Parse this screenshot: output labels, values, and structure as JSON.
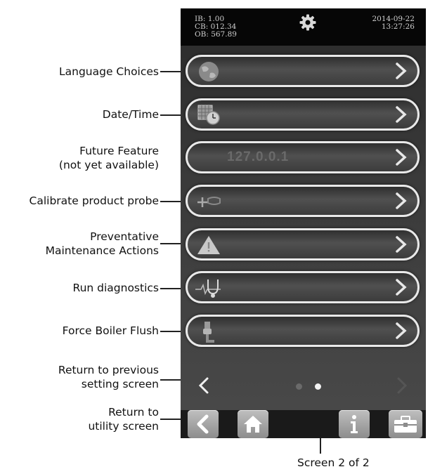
{
  "callouts": {
    "language": "Language Choices",
    "datetime": "Date/Time",
    "future_1": "Future Feature",
    "future_2": "(not yet available)",
    "calibrate": "Calibrate product probe",
    "maint_1": "Preventative",
    "maint_2": "Maintenance Actions",
    "diagnostics": "Run diagnostics",
    "boiler": "Force Boiler Flush",
    "prev_1": "Return to previous",
    "prev_2": "setting screen",
    "utility_1": "Return to",
    "utility_2": "utility screen",
    "screen_count": "Screen 2 of 2"
  },
  "status": {
    "ib": "IB: 1.00",
    "cb": "CB: 012.34",
    "ob": "OB: 567.89",
    "date": "2014-09-22",
    "time": "13:27:26"
  },
  "rows": {
    "future_text": "127.0.0.1"
  },
  "icons": [
    "gear-icon",
    "globe-icon",
    "calendar-clock-icon",
    "probe-icon",
    "warning-icon",
    "stethoscope-icon",
    "valve-icon",
    "chevron-right-icon",
    "back-icon",
    "home-icon",
    "info-icon",
    "toolbox-icon"
  ],
  "pager": {
    "current_page": 2,
    "total_pages": 2
  },
  "colors": {
    "screen_bg": "#3a3a3a",
    "row_border": "#e9e9e9",
    "button": "#a8a8a8",
    "warning": "#c9c9c9"
  }
}
